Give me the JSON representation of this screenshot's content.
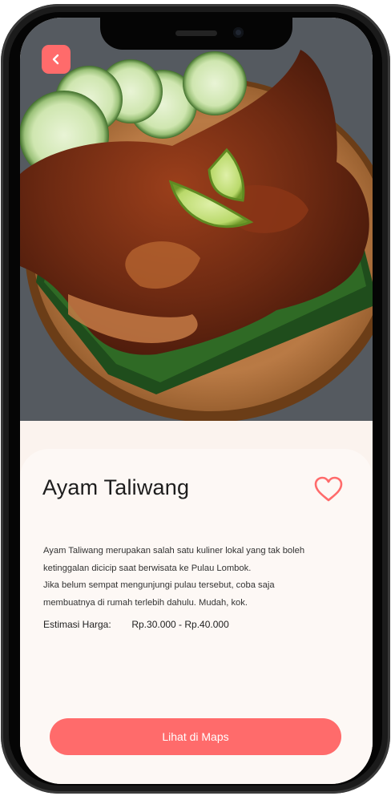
{
  "header": {
    "back_icon": "chevron-left-icon"
  },
  "food": {
    "title": "Ayam Taliwang",
    "description_lines": [
      "Ayam Taliwang merupakan salah satu kuliner lokal yang tak boleh",
      "ketinggalan dicicip saat berwisata ke Pulau Lombok.",
      "Jika belum sempat mengunjungi pulau tersebut, coba saja",
      "membuatnya di rumah terlebih dahulu. Mudah, kok."
    ],
    "price_label": "Estimasi Harga:",
    "price_value": "Rp.30.000 - Rp.40.000",
    "favorite_icon": "heart-outline-icon"
  },
  "actions": {
    "maps_label": "Lihat di Maps"
  },
  "colors": {
    "accent": "#ff6b6b",
    "sheet": "#fdf8f5",
    "background": "#fbf3ee"
  }
}
